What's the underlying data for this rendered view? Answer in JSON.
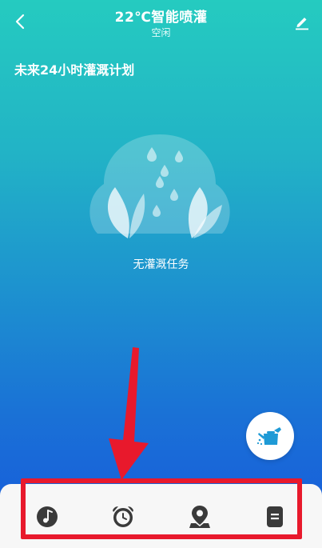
{
  "header": {
    "title": "22℃智能喷灌",
    "status": "空闲"
  },
  "section": {
    "title": "未来24小时灌溉计划"
  },
  "empty_state": {
    "text": "无灌溉任务"
  },
  "icons": {
    "back": "back-arrow-icon",
    "edit": "pencil-icon",
    "fab": "watering-can-icon",
    "nav": [
      "music-note-icon",
      "alarm-clock-icon",
      "map-pin-icon",
      "document-icon"
    ]
  },
  "colors": {
    "bg_top": "#25cbc0",
    "bg_bottom": "#1758dc",
    "highlight": "#e8192c",
    "icon_dark": "#3a3a3a",
    "fab_icon": "#1e9ad6"
  }
}
